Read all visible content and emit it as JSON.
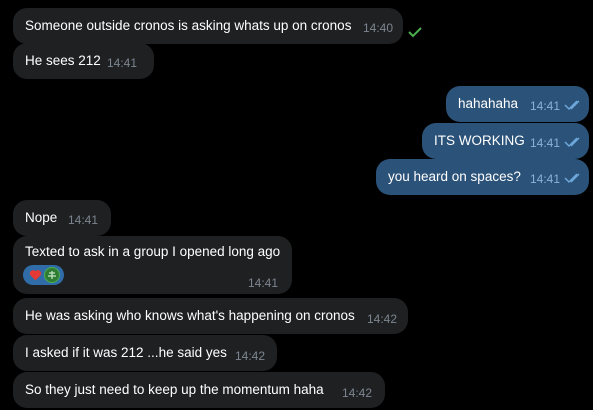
{
  "messages": [
    {
      "text": "Someone outside cronos is asking whats up on cronos",
      "time": "14:40"
    },
    {
      "text": "He sees 212",
      "time": "14:41"
    },
    {
      "text": "hahahaha",
      "time": "14:41"
    },
    {
      "text": "ITS WORKING",
      "time": "14:41"
    },
    {
      "text": "you heard on spaces?",
      "time": "14:41"
    },
    {
      "text": "Nope",
      "time": "14:41"
    },
    {
      "text": "Texted to ask in a group I opened long ago",
      "time": "14:41",
      "reactions": [
        "heart-emoji",
        "reactor-avatar"
      ]
    },
    {
      "text": "He was asking who knows what's happening on cronos",
      "time": "14:42"
    },
    {
      "text": "I asked if it was 212 ...he said yes",
      "time": "14:42"
    },
    {
      "text": "So they just need to keep up the momentum haha",
      "time": "14:42"
    }
  ],
  "colors": {
    "background": "#000000",
    "incoming_bubble": "#1f2022",
    "outgoing_bubble": "#2b5278",
    "read_check_out": "#6fa8dc",
    "read_check_sent": "#4caf50",
    "reaction_chip": "#2f6ca8",
    "heart": "#e53935"
  }
}
